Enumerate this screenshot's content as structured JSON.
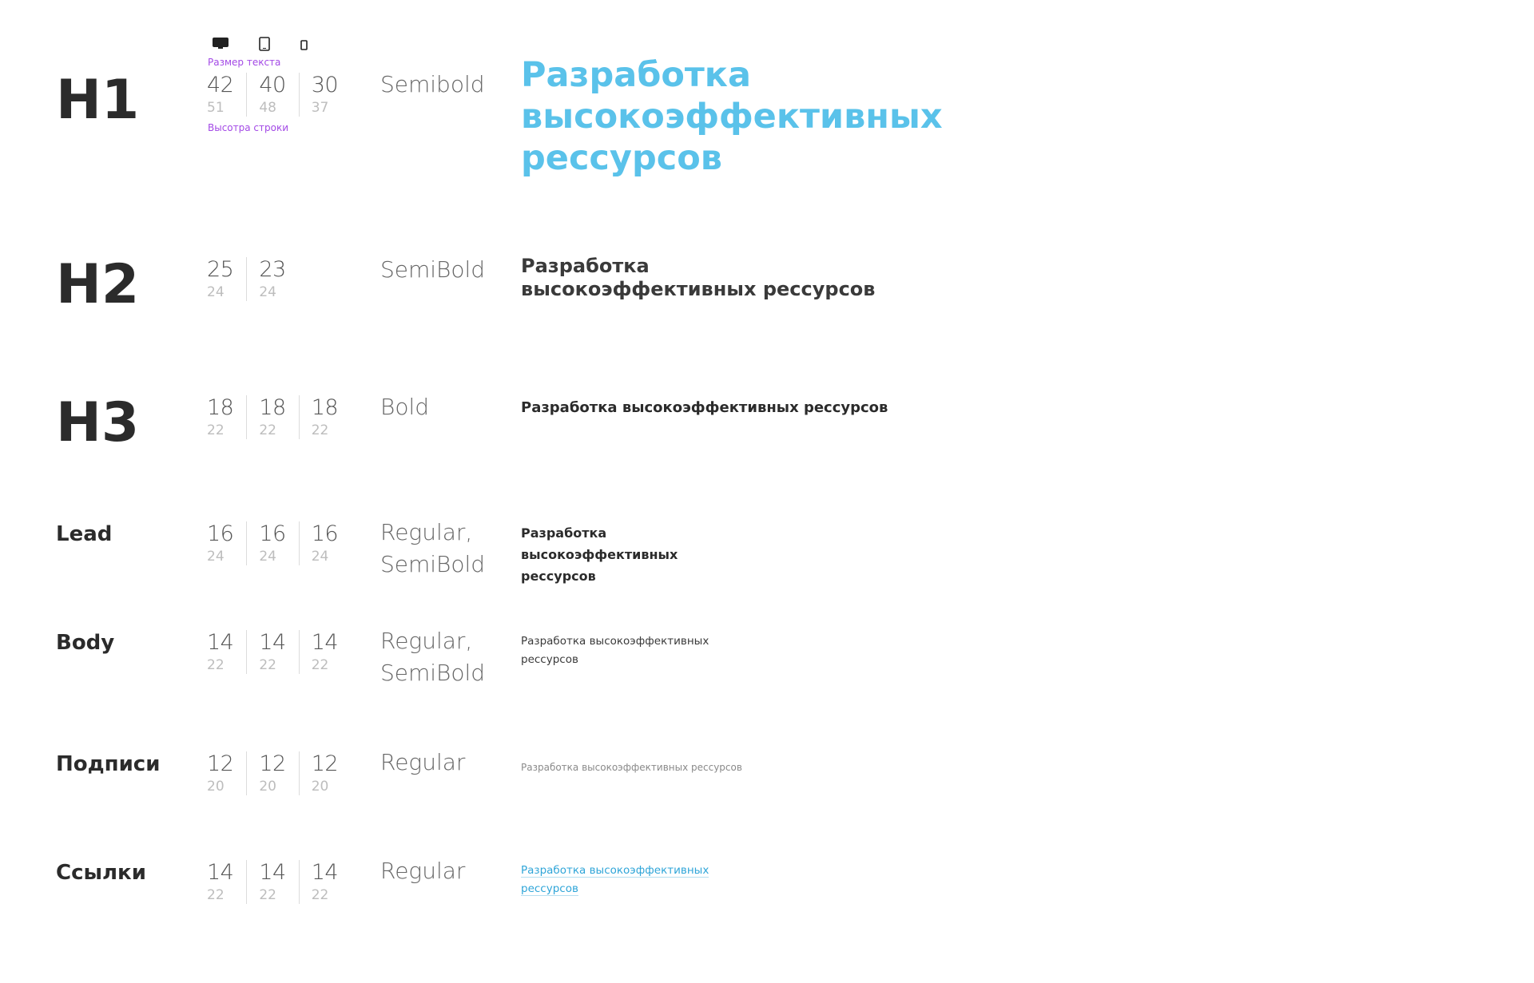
{
  "annotations": {
    "font_size_label": "Размер текста",
    "line_height_label": "Высотра строки"
  },
  "devices": [
    "desktop-icon",
    "tablet-icon",
    "mobile-icon"
  ],
  "colors": {
    "h1_sample": "#5ac2ea",
    "link": "#2fa5d8",
    "annotation": "#a349e6"
  },
  "rows": [
    {
      "name": "H1",
      "sizes": [
        {
          "fs": "42",
          "lh": "51"
        },
        {
          "fs": "40",
          "lh": "48"
        },
        {
          "fs": "30",
          "lh": "37"
        }
      ],
      "weight_line1": "Semibold",
      "weight_line2": "",
      "sample": "Разработка высокоэффективных рессурсов"
    },
    {
      "name": "H2",
      "sizes": [
        {
          "fs": "25",
          "lh": "24"
        },
        {
          "fs": "23",
          "lh": "24"
        }
      ],
      "weight_line1": "SemiBold",
      "weight_line2": "",
      "sample": "Разработка высокоэффективных рессурсов"
    },
    {
      "name": "H3",
      "sizes": [
        {
          "fs": "18",
          "lh": "22"
        },
        {
          "fs": "18",
          "lh": "22"
        },
        {
          "fs": "18",
          "lh": "22"
        }
      ],
      "weight_line1": "Bold",
      "weight_line2": "",
      "sample": "Разработка высокоэффективных рессурсов"
    },
    {
      "name": "Lead",
      "sizes": [
        {
          "fs": "16",
          "lh": "24"
        },
        {
          "fs": "16",
          "lh": "24"
        },
        {
          "fs": "16",
          "lh": "24"
        }
      ],
      "weight_line1": "Regular,",
      "weight_line2": "SemiBold",
      "sample": "Разработка высокоэффективных рессурсов"
    },
    {
      "name": "Body",
      "sizes": [
        {
          "fs": "14",
          "lh": "22"
        },
        {
          "fs": "14",
          "lh": "22"
        },
        {
          "fs": "14",
          "lh": "22"
        }
      ],
      "weight_line1": "Regular,",
      "weight_line2": "SemiBold",
      "sample": "Разработка высокоэффективных рессурсов"
    },
    {
      "name": "Подписи",
      "sizes": [
        {
          "fs": "12",
          "lh": "20"
        },
        {
          "fs": "12",
          "lh": "20"
        },
        {
          "fs": "12",
          "lh": "20"
        }
      ],
      "weight_line1": "Regular",
      "weight_line2": "",
      "sample": "Разработка высокоэффективных рессурсов"
    },
    {
      "name": "Ссылки",
      "sizes": [
        {
          "fs": "14",
          "lh": "22"
        },
        {
          "fs": "14",
          "lh": "22"
        },
        {
          "fs": "14",
          "lh": "22"
        }
      ],
      "weight_line1": "Regular",
      "weight_line2": "",
      "sample_line1": "Разработка высокоэффективных",
      "sample_line2": "рессурсов"
    }
  ]
}
